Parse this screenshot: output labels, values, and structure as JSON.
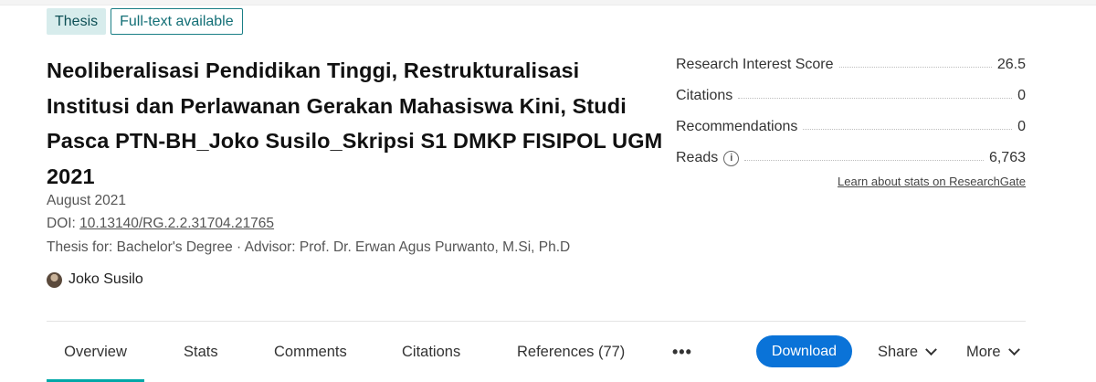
{
  "badges": {
    "type": "Thesis",
    "availability": "Full-text available"
  },
  "publication": {
    "title": "Neoliberalisasi Pendidikan Tinggi, Restrukturalisasi Institusi dan Perlawanan Gerakan Mahasiswa Kini, Studi Pasca PTN-BH_Joko Susilo_Skripsi S1 DMKP FISIPOL UGM 2021",
    "date": "August 2021",
    "doi_label": "DOI: ",
    "doi": "10.13140/RG.2.2.31704.21765",
    "thesis_info": "Thesis for: Bachelor's Degree · Advisor: Prof. Dr. Erwan Agus Purwanto, M.Si, Ph.D",
    "author": "Joko Susilo"
  },
  "stats": {
    "rows": [
      {
        "label": "Research Interest Score",
        "value": "26.5"
      },
      {
        "label": "Citations",
        "value": "0"
      },
      {
        "label": "Recommendations",
        "value": "0"
      },
      {
        "label": "Reads",
        "value": "6,763"
      }
    ],
    "info_icon": "info-circle-icon",
    "learn_link": "Learn about stats on ResearchGate"
  },
  "tabs": {
    "overview": "Overview",
    "stats": "Stats",
    "comments": "Comments",
    "citations": "Citations",
    "references": "References (77)",
    "more_dots": "•••"
  },
  "actions": {
    "download": "Download",
    "share": "Share",
    "more": "More"
  },
  "colors": {
    "accent": "#00a7a7",
    "download_button": "#0a73d8",
    "thesis_badge_bg": "#d7ecec",
    "fulltext_border": "#1a7f86"
  }
}
